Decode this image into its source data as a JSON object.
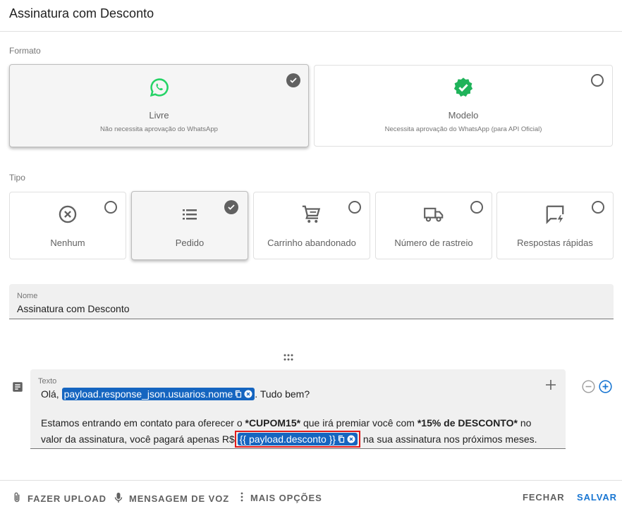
{
  "dialog": {
    "title": "Assinatura com Desconto"
  },
  "formato": {
    "label": "Formato",
    "options": [
      {
        "title": "Livre",
        "subtitle": "Não necessita aprovação do WhatsApp",
        "selected": true,
        "icon": "whatsapp-icon"
      },
      {
        "title": "Modelo",
        "subtitle": "Necessita aprovação do WhatsApp (para API Oficial)",
        "selected": false,
        "icon": "verified-badge-icon"
      }
    ]
  },
  "tipo": {
    "label": "Tipo",
    "options": [
      {
        "title": "Nenhum",
        "selected": false,
        "icon": "circle-x-icon"
      },
      {
        "title": "Pedido",
        "selected": true,
        "icon": "list-icon"
      },
      {
        "title": "Carrinho abandonado",
        "selected": false,
        "icon": "cart-icon"
      },
      {
        "title": "Número de rastreio",
        "selected": false,
        "icon": "truck-icon"
      },
      {
        "title": "Respostas rápidas",
        "selected": false,
        "icon": "quick-reply-icon"
      }
    ]
  },
  "nome": {
    "label": "Nome",
    "value": "Assinatura com Desconto"
  },
  "texto": {
    "label": "Texto",
    "line1_before": "Olá, ",
    "chip1": "payload.response_json.usuarios.nome",
    "line1_after": ". Tudo bem?",
    "line2_a": "Estamos entrando em contato para oferecer o ",
    "line2_b": "*CUPOM15*",
    "line2_c": " que irá premiar você com ",
    "line2_d": "*15% de DESCONTO*",
    "line2_e": " no",
    "line3_a": "valor da assinatura, você pagará apenas R$",
    "chip2": "{{ payload.desconto }}",
    "line3_b": " na sua assinatura nos próximos meses."
  },
  "footer": {
    "upload": "FAZER UPLOAD",
    "voice": "MENSAGEM DE VOZ",
    "more": "MAIS OPÇÕES",
    "close": "FECHAR",
    "save": "SALVAR"
  },
  "colors": {
    "primary": "#1976d2",
    "chip": "#1565c0",
    "whatsapp": "#25d366",
    "highlight": "#e01b1b"
  }
}
